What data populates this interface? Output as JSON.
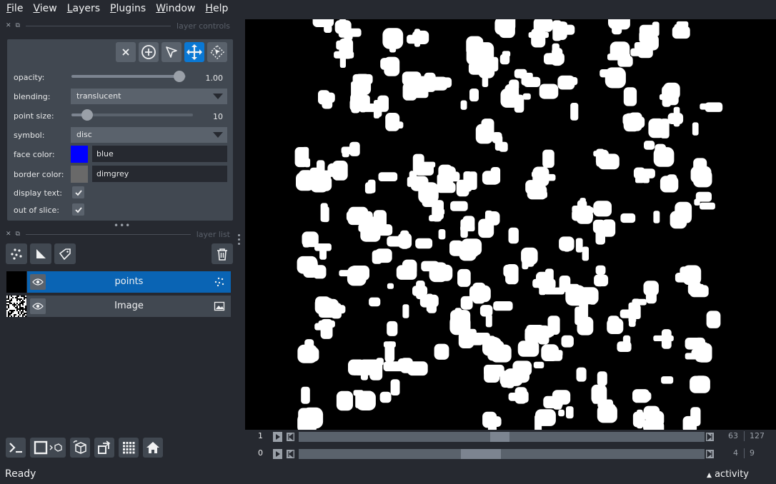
{
  "menubar": {
    "items": [
      {
        "accel": "F",
        "rest": "ile"
      },
      {
        "accel": "V",
        "rest": "iew"
      },
      {
        "accel": "L",
        "rest": "ayers"
      },
      {
        "accel": "P",
        "rest": "lugins"
      },
      {
        "accel": "W",
        "rest": "indow"
      },
      {
        "accel": "H",
        "rest": "elp"
      }
    ]
  },
  "layer_controls": {
    "title": "layer controls",
    "opacity": {
      "label": "opacity:",
      "value": "1.00",
      "fraction": 1.0
    },
    "blending": {
      "label": "blending:",
      "value": "translucent"
    },
    "point_size": {
      "label": "point size:",
      "value": "10",
      "fraction": 0.1
    },
    "symbol": {
      "label": "symbol:",
      "value": "disc"
    },
    "face_color": {
      "label": "face color:",
      "value": "blue",
      "hex": "#0000ff"
    },
    "border_color": {
      "label": "border color:",
      "value": "dimgrey",
      "hex": "#696969"
    },
    "display_text": {
      "label": "display text:",
      "checked": true
    },
    "out_of_slice": {
      "label": "out of slice:",
      "checked": true
    },
    "mode_buttons": [
      "delete-icon",
      "add-points-icon",
      "select-arrow-icon",
      "pan-zoom-icon",
      "transform-icon"
    ],
    "active_mode": "pan-zoom-icon"
  },
  "layer_list": {
    "title": "layer list",
    "layers": [
      {
        "name": "points",
        "type_icon": "points-icon",
        "visible": true,
        "selected": true
      },
      {
        "name": "Image",
        "type_icon": "image-icon",
        "visible": true,
        "selected": false
      }
    ]
  },
  "dims": [
    {
      "axis": "1",
      "current": "63",
      "max": "127",
      "position": 0.5
    },
    {
      "axis": "0",
      "current": "4",
      "max": "9",
      "position": 0.45
    }
  ],
  "status": {
    "text": "Ready",
    "activity": "activity"
  },
  "colors": {
    "accent": "#0a78d4",
    "panel": "#414851",
    "background": "#262930"
  }
}
